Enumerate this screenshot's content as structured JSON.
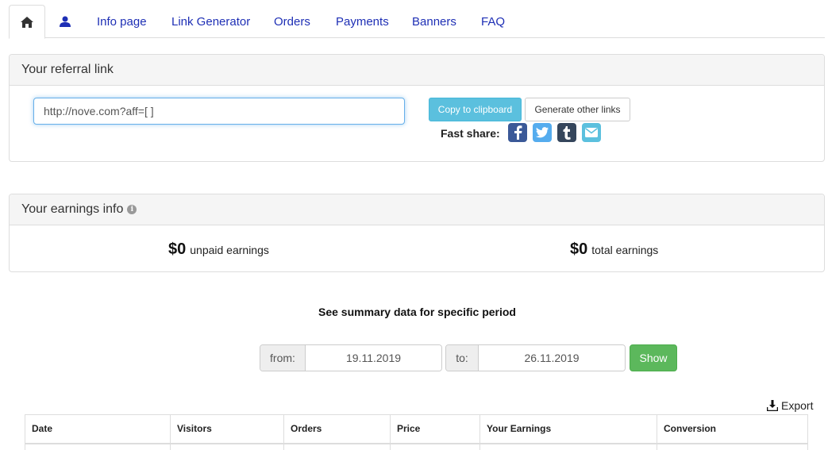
{
  "tabs": {
    "home_icon": "home-icon",
    "user_icon": "user-icon",
    "items": [
      "Info page",
      "Link Generator",
      "Orders",
      "Payments",
      "Banners",
      "FAQ"
    ]
  },
  "referral": {
    "title": "Your referral link",
    "link_value": "http://nove.com?aff=[ ]",
    "copy_label": "Copy to clipboard",
    "generate_label": "Generate other links",
    "fast_share_label": "Fast share:",
    "share_icons": [
      "facebook-icon",
      "twitter-icon",
      "tumblr-icon",
      "email-icon"
    ]
  },
  "earnings": {
    "title": "Your earnings info",
    "unpaid_amount": "$0",
    "unpaid_label": "unpaid earnings",
    "total_amount": "$0",
    "total_label": "total earnings"
  },
  "summary": {
    "title": "See summary data for specific period",
    "from_label": "from:",
    "from_value": "19.11.2019",
    "to_label": "to:",
    "to_value": "26.11.2019",
    "show_label": "Show",
    "export_label": "Export"
  },
  "table": {
    "columns": [
      "Date",
      "Visitors",
      "Orders",
      "Price",
      "Your Earnings",
      "Conversion"
    ]
  },
  "colors": {
    "link": "#1e2fb5",
    "info_button": "#5bc0de",
    "success_button": "#5cb85c",
    "facebook": "#3b5998",
    "twitter": "#55acee",
    "tumblr": "#35465c",
    "email": "#5bc0de"
  }
}
